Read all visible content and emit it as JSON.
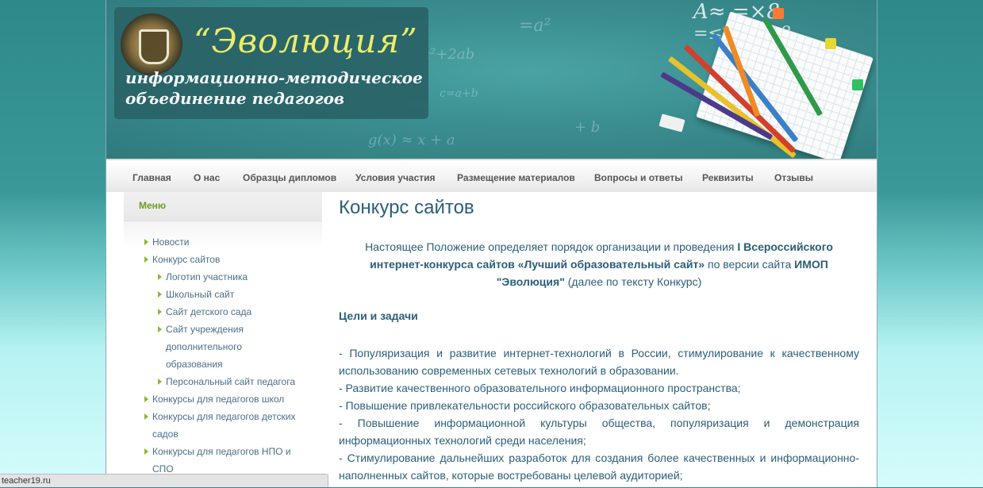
{
  "header": {
    "logo_title": "“Эволюция”",
    "logo_sub1": "информационно-методическое",
    "logo_sub2": "объединение педагогов"
  },
  "nav": [
    "Главная",
    "О нас",
    "Образцы дипломов",
    "Условия участия",
    "Размещение материалов",
    "Вопросы и ответы",
    "Реквизиты",
    "Отзывы"
  ],
  "sidebar": {
    "heading": "Меню",
    "items": [
      {
        "label": "Новости",
        "level": 0
      },
      {
        "label": "Конкурс сайтов",
        "level": 0
      },
      {
        "label": "Логотип участника",
        "level": 1
      },
      {
        "label": "Школьный сайт",
        "level": 1
      },
      {
        "label": "Сайт детского сада",
        "level": 1
      },
      {
        "label": "Сайт учреждения",
        "cont": [
          "дополнительного",
          "образования"
        ],
        "level": 1
      },
      {
        "label": "Персональный сайт педагога",
        "level": 1
      },
      {
        "label": "Конкурсы для педагогов школ",
        "level": 0
      },
      {
        "label": "Конкурсы для педагогов детских",
        "cont": [
          "садов"
        ],
        "level": 0
      },
      {
        "label": "Конкурсы для педагогов НПО и",
        "cont": [
          "СПО"
        ],
        "level": 0
      }
    ]
  },
  "main": {
    "title": "Конкурс сайтов",
    "intro": {
      "p1": "Настоящее Положение определяет порядок организации и проведения ",
      "b1": "I Всероссийского интернет-конкурса сайтов «Лучший образовательный сайт»",
      "p2": " по версии сайта ",
      "b2": "ИМОП \"Эволюция\"",
      "p3": " (далее по тексту Конкурс)"
    },
    "goals_title": "Цели и задачи",
    "goals": [
      "- Популяризация и развитие  интернет-технологий в России, стимулирование к качественному использованию современных сетевых технологий в образовании.",
      "- Развитие качественного образовательного информационного пространства;",
      "- Повышение привлекательности российского образовательных сайтов;",
      "- Повышение информационной культуры общества, популяризация и демонстрация информационных технологий среди населения;",
      "- Стимулирование дальнейших разработок для создания более качественных и информационно-наполненных сайтов, которые востребованы целевой аудиторией;"
    ]
  },
  "status_bar": "teacher19.ru",
  "colors": {
    "accent_green": "#8cb830",
    "text_blue": "#2b5e78",
    "logo_yellow": "#f4f26a"
  }
}
